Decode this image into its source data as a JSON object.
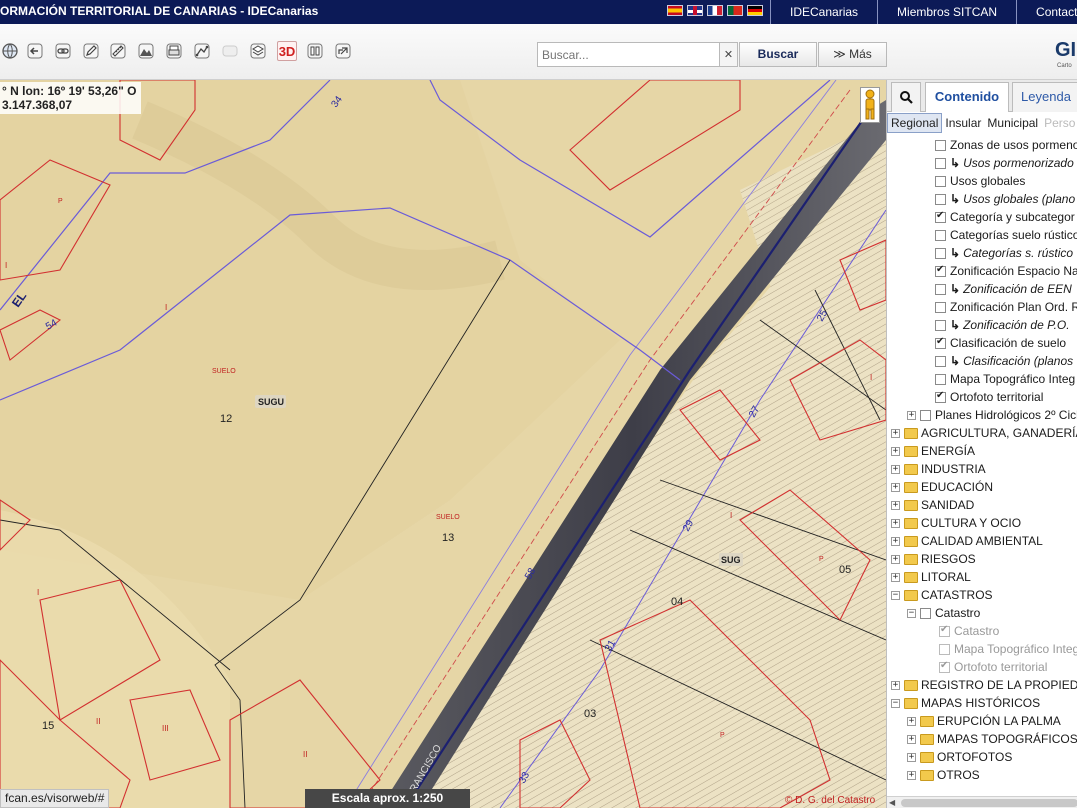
{
  "topbar": {
    "title": "ORMACIÓN TERRITORIAL DE CANARIAS - IDECanarias",
    "flags": [
      "es",
      "gb",
      "fr",
      "pt",
      "de"
    ],
    "links": [
      "IDECanarias",
      "Miembros SITCAN",
      "Contacto"
    ]
  },
  "toolbar": {
    "tools": [
      "globe-icon",
      "back-icon",
      "link-icon",
      "pencil-icon",
      "ruler-icon",
      "profile-icon",
      "print-icon",
      "route-icon",
      "disabled-icon",
      "layers-icon",
      "3d-icon",
      "book-icon",
      "export-icon"
    ],
    "three_d_label": "3D",
    "search_placeholder": "Buscar...",
    "clear_label": "✕",
    "search_label": "Buscar",
    "more_label": "≫ Más",
    "logo": "GI",
    "logo_sub": "Carto"
  },
  "map": {
    "coords_line1": "° N  lon: 16º 19' 53,26\" O",
    "coords_line2": "3.147.368,07",
    "labels": {
      "n34": "34",
      "el": "EL",
      "n54": "54",
      "p1": "P",
      "i1": "I",
      "suelo12": "SUELO",
      "n12": "12",
      "sugu": "SUGU",
      "suelo13": "SUELO",
      "n13": "13",
      "n58": "58",
      "n25": "25",
      "n27": "27",
      "n29": "29",
      "sug": "SUG",
      "n05": "05",
      "n04": "04",
      "n31": "31",
      "n03": "03",
      "n15": "15",
      "ii1": "II",
      "iii1": "III",
      "ii2": "II",
      "n33": "33",
      "francisco": "FRANCISCO",
      "p2": "P",
      "p3": "P",
      "i2": "I",
      "i3": "I",
      "i4": "I",
      "i5": "I"
    },
    "status_url": "fcan.es/visorweb/#",
    "scale": "Escala aprox. 1:250",
    "copyright": "© D. G. del Catastro"
  },
  "panel": {
    "tabs": [
      "Contenido",
      "Leyenda"
    ],
    "scope_tabs": [
      "Regional",
      "Insular",
      "Municipal",
      "Perso"
    ],
    "tree": [
      {
        "label": "Zonas de usos pormeno",
        "type": "layer",
        "checked": false,
        "indent": 48,
        "italic": false
      },
      {
        "label": "Usos pormenorizado",
        "type": "sublayer",
        "checked": false,
        "indent": 48,
        "italic": true
      },
      {
        "label": "Usos globales",
        "type": "layer",
        "checked": false,
        "indent": 48,
        "italic": false
      },
      {
        "label": "Usos globales (plano",
        "type": "sublayer",
        "checked": false,
        "indent": 48,
        "italic": true
      },
      {
        "label": "Categoría y subcategor",
        "type": "layer",
        "checked": true,
        "indent": 48,
        "italic": false
      },
      {
        "label": "Categorías suelo rústico",
        "type": "layer",
        "checked": false,
        "indent": 48,
        "italic": false
      },
      {
        "label": "Categorías s. rústico",
        "type": "sublayer",
        "checked": false,
        "indent": 48,
        "italic": true
      },
      {
        "label": "Zonificación Espacio Na",
        "type": "layer",
        "checked": true,
        "indent": 48,
        "italic": false
      },
      {
        "label": "Zonificación de EEN",
        "type": "sublayer",
        "checked": false,
        "indent": 48,
        "italic": true
      },
      {
        "label": "Zonificación Plan Ord. R",
        "type": "layer",
        "checked": false,
        "indent": 48,
        "italic": false
      },
      {
        "label": "Zonificación de P.O.",
        "type": "sublayer",
        "checked": false,
        "indent": 48,
        "italic": true
      },
      {
        "label": "Clasificación de suelo",
        "type": "layer",
        "checked": true,
        "indent": 48,
        "italic": false
      },
      {
        "label": "Clasificación (planos",
        "type": "sublayer",
        "checked": false,
        "indent": 48,
        "italic": true
      },
      {
        "label": "Mapa Topográfico Integ",
        "type": "layer",
        "checked": false,
        "indent": 48,
        "italic": false
      },
      {
        "label": "Ortofoto territorial",
        "type": "layer",
        "checked": true,
        "indent": 48,
        "italic": false
      },
      {
        "label": "Planes Hidrológicos 2º Cicl",
        "type": "group-cb",
        "checked": false,
        "indent": 20,
        "italic": false
      },
      {
        "label": "AGRICULTURA, GANADERÍA y",
        "type": "folder",
        "indent": 4
      },
      {
        "label": "ENERGÍA",
        "type": "folder",
        "indent": 4
      },
      {
        "label": "INDUSTRIA",
        "type": "folder",
        "indent": 4
      },
      {
        "label": "EDUCACIÓN",
        "type": "folder",
        "indent": 4
      },
      {
        "label": "SANIDAD",
        "type": "folder",
        "indent": 4
      },
      {
        "label": "CULTURA Y OCIO",
        "type": "folder",
        "indent": 4
      },
      {
        "label": "CALIDAD AMBIENTAL",
        "type": "folder",
        "indent": 4
      },
      {
        "label": "RIESGOS",
        "type": "folder",
        "indent": 4
      },
      {
        "label": "LITORAL",
        "type": "folder",
        "indent": 4
      },
      {
        "label": "CATASTROS",
        "type": "folder-open",
        "indent": 4
      },
      {
        "label": "Catastro",
        "type": "group-cb-open",
        "checked": false,
        "indent": 20,
        "italic": false
      },
      {
        "label": "Catastro",
        "type": "layer-dim",
        "checked": true,
        "indent": 52,
        "italic": false
      },
      {
        "label": "Mapa Topográfico Integ",
        "type": "layer-dim",
        "checked": false,
        "indent": 52,
        "italic": false
      },
      {
        "label": "Ortofoto territorial",
        "type": "layer-dim",
        "checked": true,
        "indent": 52,
        "italic": false
      },
      {
        "label": "REGISTRO DE LA PROPIEDAD",
        "type": "folder",
        "indent": 4
      },
      {
        "label": "MAPAS HISTÓRICOS",
        "type": "folder-open",
        "indent": 4
      },
      {
        "label": "ERUPCIÓN LA PALMA",
        "type": "folder",
        "indent": 20
      },
      {
        "label": "MAPAS TOPOGRÁFICOS",
        "type": "folder",
        "indent": 20
      },
      {
        "label": "ORTOFOTOS",
        "type": "folder",
        "indent": 20
      },
      {
        "label": "OTROS",
        "type": "folder",
        "indent": 20
      }
    ]
  },
  "colors": {
    "topbar": "#0c1a57",
    "map_base": "#e8d8a8",
    "parcel_red": "#d23030",
    "boundary_blue": "#6a5bd8",
    "road": "#4a4a55"
  }
}
